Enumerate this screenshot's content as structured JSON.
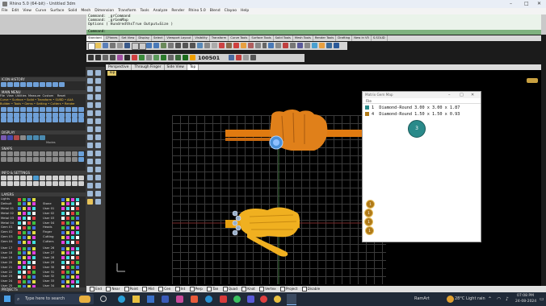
{
  "window": {
    "title": "Rhino 5.0 (64-bit) - Untitled 3dm"
  },
  "menu": [
    "File",
    "Edit",
    "View",
    "Curve",
    "Surface",
    "Solid",
    "Mesh",
    "Dimension",
    "Transform",
    "Tools",
    "Analyze",
    "Render",
    "Rhino 5.0",
    "Blend",
    "Clayoo",
    "Help"
  ],
  "command": {
    "history": [
      "Command: _grCommand",
      "Command: _grGemMap",
      "Options ( HundredthsTrue  Output=Size )"
    ],
    "prompt": "Command:"
  },
  "toolbar_tabs": [
    "Standard",
    "CPlanes",
    "Set View",
    "Display",
    "Select",
    "Viewport Layout",
    "Visibility",
    "Transform",
    "Curve Tools",
    "Surface Tools",
    "Solid Tools",
    "Mesh Tools",
    "Render Tools",
    "Drafting",
    "New in V5",
    "S.SOLID"
  ],
  "toolbar_readout": "100501",
  "left_panel": {
    "icon_history": "ICON HISTORY",
    "main_menu": "MAIN MENU",
    "main_menu_tabs": [
      "File",
      "View",
      "Utilities",
      "Measure",
      "Custom",
      "Reset"
    ],
    "main_menu_rows": [
      "Curve • Surface • Solid • Transform • SUBD • AAA",
      "Builder • Tools • Gems • Setting • Cutters • Render"
    ],
    "display": "DISPLAY",
    "display_label": "Modes",
    "snaps": "SNAPS",
    "info_settings": "INFO & SETTINGS",
    "layers": "LAYERS",
    "projects": "PROJECTS",
    "layers_col1": [
      "Lights",
      "Default",
      "Metal 01",
      "Metal 02",
      "Metal 03",
      "Metal 04",
      "Gem 01",
      "Gem 02",
      "Gem 03",
      "Gem 04"
    ],
    "layers_col2": [
      "",
      "Stone",
      "User 01",
      "User 02",
      "User 03",
      "User 04",
      "Heads",
      "Finger",
      "Cutting",
      "Cutters"
    ],
    "users_col1": [
      "User 17",
      "User 18",
      "User 19",
      "User 20",
      "User 21",
      "User 22",
      "User 23",
      "User 24",
      "User 25"
    ],
    "users_col2": [
      "User 26",
      "User 27",
      "User 28",
      "User 29",
      "User 30",
      "User 31",
      "User 32",
      "User 33",
      "User 34"
    ]
  },
  "viewport": {
    "tabs": [
      "Perspective",
      "Through Finger",
      "Side View",
      "Top"
    ],
    "active_tab": "Top",
    "label": "Top"
  },
  "gem_map": {
    "title": "Matrix Gem Map",
    "menu": "File",
    "rows": [
      {
        "index": "1",
        "text": "Diamond-Round 3.00 x 3.00 x 1.87",
        "color": "#2a8a8a"
      },
      {
        "index": "4",
        "text": "Diamond-Round 1.50 x 1.50 x 0.93",
        "color": "#b07a18"
      }
    ],
    "circle_label": "3",
    "bubbles": [
      "1",
      "1",
      "1",
      "1"
    ]
  },
  "osnaps": [
    "End",
    "Near",
    "Point",
    "Mid",
    "Cen",
    "Int",
    "Perp",
    "Tan",
    "Quad",
    "Knot",
    "Vertex",
    "Project",
    "Disable"
  ],
  "taskbar": {
    "search_placeholder": "Type here to search",
    "ram": "RamArt",
    "weather": "28°C  Light rain",
    "time": "07:08 PM",
    "date": "24-08-2024"
  },
  "colors": {
    "gold": "#f0a000",
    "gem_teal": "#2a8a8a",
    "gem_gold": "#b07a18",
    "cmd_green": "#7fb27f"
  }
}
